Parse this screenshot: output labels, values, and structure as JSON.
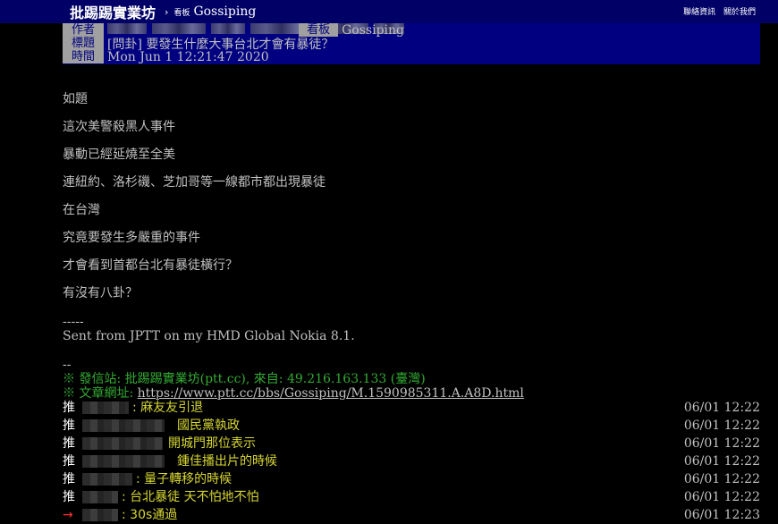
{
  "topbar": {
    "site": "批踢踢實業坊",
    "separator": "›",
    "board_label": "看板",
    "board": "Gossiping",
    "links": [
      "聯絡資訊",
      "關於我們"
    ]
  },
  "meta": {
    "author_label": "作者",
    "title_label": "標題",
    "time_label": "時間",
    "board_label": "看板",
    "board": "Gossiping",
    "title": "[問卦] 要發生什麼大事台北才會有暴徒？",
    "time": "Mon Jun  1 12:21:47 2020"
  },
  "body": [
    "如題",
    "這次美警殺黑人事件",
    "暴動已經延燒至全美",
    "連紐約、洛杉磯、芝加哥等一線都市都出現暴徒",
    "在台灣",
    "究竟要發生多嚴重的事件",
    "才會看到首都台北有暴徒橫行？",
    "有沒有八卦？"
  ],
  "signature": {
    "divider": "-----",
    "text": "Sent from JPTT on my HMD Global Nokia 8.1."
  },
  "footer": {
    "dashes": "--",
    "source": "※ 發信站: 批踢踢實業坊(ptt.cc), 來自: 49.216.163.133 (臺灣)",
    "url_label": "※ 文章網址: ",
    "url": "https://www.ptt.cc/bbs/Gossiping/M.1590985311.A.A8D.html"
  },
  "pushes": [
    {
      "tag": "推",
      "content": ": 麻友友引退",
      "time": "06/01 12:22"
    },
    {
      "tag": "推",
      "content": "國民黨執政",
      "time": "06/01 12:22"
    },
    {
      "tag": "推",
      "content": "開城門那位表示",
      "time": "06/01 12:22"
    },
    {
      "tag": "推",
      "content": "鍾佳播出片的時候",
      "time": "06/01 12:22"
    },
    {
      "tag": "推",
      "content": ": 量子轉移的時候",
      "time": "06/01 12:22"
    },
    {
      "tag": "推",
      "content": ": 台北暴徒 天不怕地不怕",
      "time": "06/01 12:22"
    },
    {
      "tag": "→",
      "content": ": 30s通過",
      "time": "06/01 12:23"
    }
  ],
  "colors": {
    "topbar_bg": "#000066",
    "meta_bg": "#000080",
    "push_text": "#d6d633",
    "footer_green": "#33aa33",
    "arrow": "#ff3333"
  }
}
